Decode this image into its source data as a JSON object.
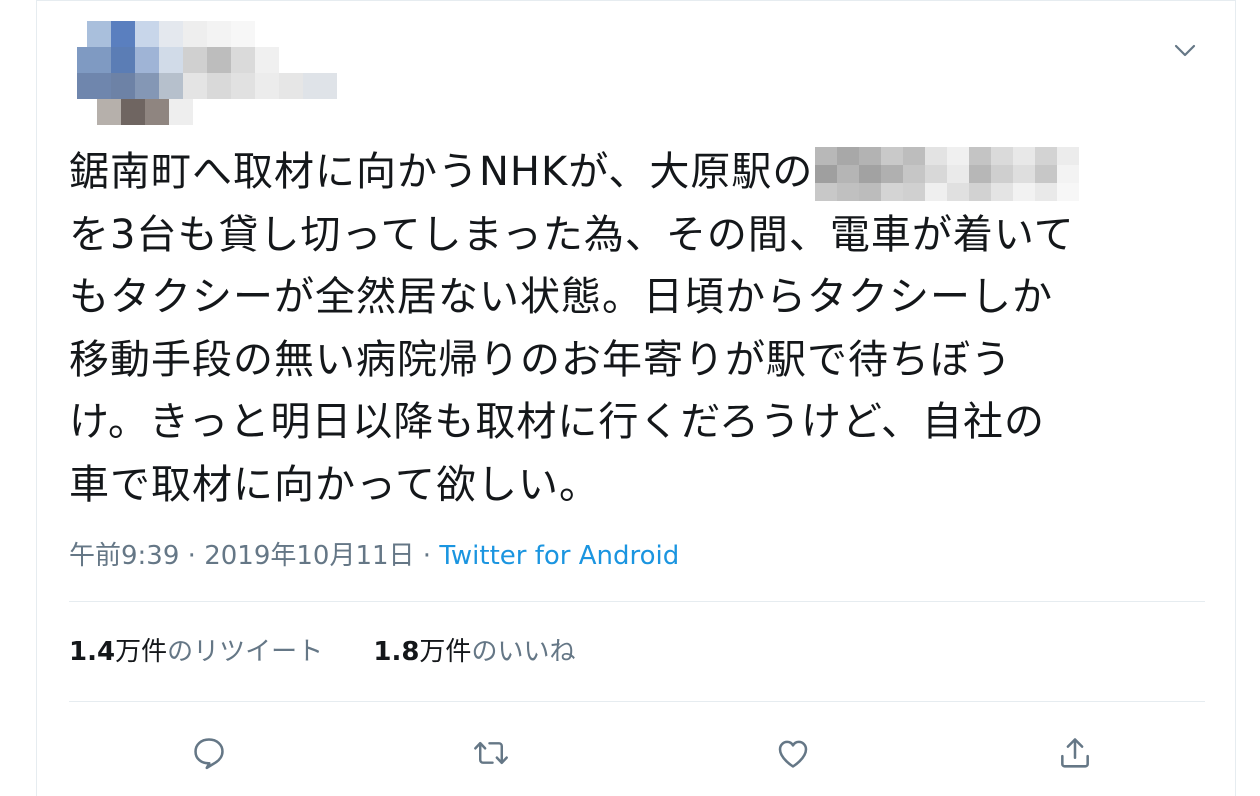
{
  "tweet": {
    "lines": [
      "鋸南町へ取材に向かうNHKが、大原駅の",
      "を3台も貸し切ってしまった為、その間、電車が着いて",
      "もタクシーが全然居ない状態。日頃からタクシーしか",
      "移動手段の無い病院帰りのお年寄りが駅で待ちぼう",
      "け。きっと明日以降も取材に行くだろうけど、自社の",
      "車で取材に向かって欲しい。"
    ],
    "time": "午前9:39",
    "separator": "·",
    "date": "2019年10月11日",
    "source": "Twitter for Android"
  },
  "stats": {
    "retweets_count": "1.4",
    "retweets_unit": "万件",
    "retweets_label": "のリツイート",
    "likes_count": "1.8",
    "likes_unit": "万件",
    "likes_label": "のいいね"
  },
  "colors": {
    "text": "#14171a",
    "secondary": "#657786",
    "link": "#1b95e0",
    "divider": "#e6ecf0",
    "icon": "#657786"
  },
  "icons": {
    "menu": "chevron-down-icon",
    "reply": "reply-icon",
    "retweet": "retweet-icon",
    "like": "heart-icon",
    "share": "share-icon"
  }
}
